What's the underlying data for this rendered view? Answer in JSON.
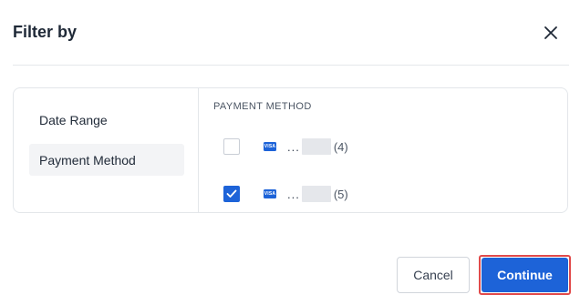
{
  "dialog": {
    "title": "Filter by",
    "close_icon": "close-icon"
  },
  "sidebar": {
    "items": [
      {
        "label": "Date Range",
        "selected": false
      },
      {
        "label": "Payment Method",
        "selected": true
      }
    ]
  },
  "payment": {
    "section_label": "PAYMENT METHOD",
    "options": [
      {
        "checked": false,
        "card_icon": "visa-card-icon",
        "brand": "VISA",
        "masked": "...",
        "count": "(4)"
      },
      {
        "checked": true,
        "card_icon": "visa-card-icon",
        "brand": "VISA",
        "masked": "...",
        "count": "(5)"
      }
    ]
  },
  "footer": {
    "cancel_label": "Cancel",
    "continue_label": "Continue"
  },
  "colors": {
    "accent": "#1d63d8",
    "highlight_border": "#e14a4a",
    "selected_bg": "#f3f4f6"
  }
}
